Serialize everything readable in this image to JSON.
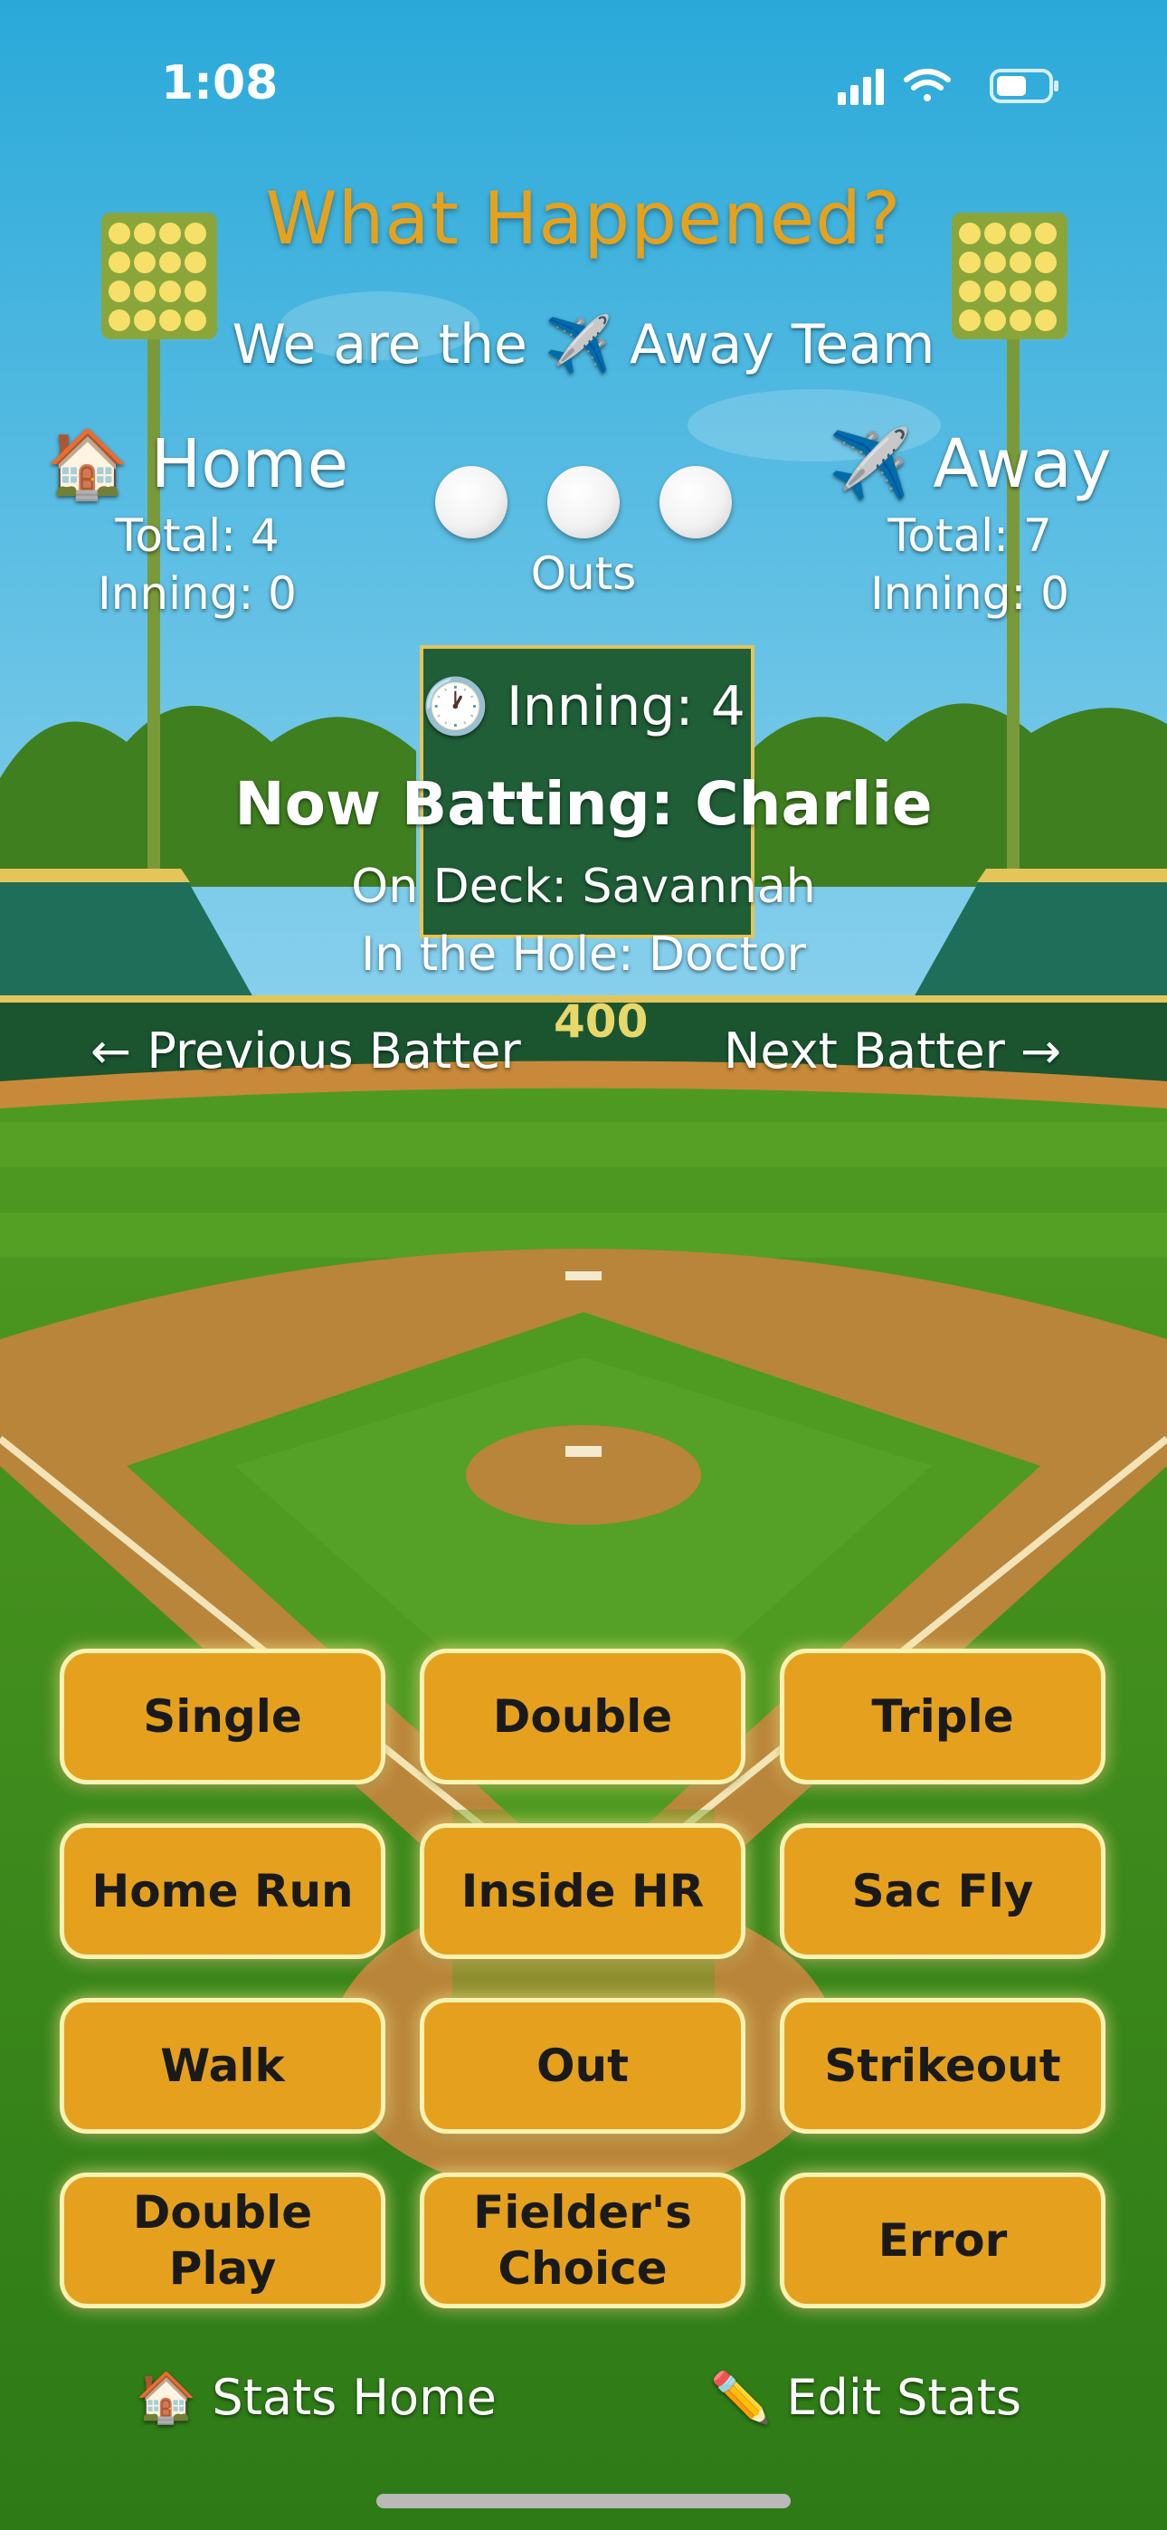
{
  "status_bar": {
    "time": "1:08"
  },
  "header": {
    "title": "What Happened?",
    "team_prefix": "We are the",
    "team_icon": "✈️",
    "team_name": "Away Team"
  },
  "home": {
    "icon": "🏠",
    "name": "Home",
    "total": "Total: 4",
    "inning": "Inning: 0"
  },
  "away": {
    "icon": "✈️",
    "name": "Away",
    "total": "Total: 7",
    "inning": "Inning: 0"
  },
  "outs": {
    "label": "Outs",
    "count": 0,
    "max": 3
  },
  "game": {
    "inning_icon": "🕐",
    "inning": "Inning: 4",
    "now_batting": "Now Batting: Charlie",
    "on_deck": "On Deck: Savannah",
    "in_hole": "In the Hole: Doctor",
    "outfield_sign": "400"
  },
  "nav": {
    "previous": "← Previous Batter",
    "next": "Next Batter →"
  },
  "plays": [
    "Single",
    "Double",
    "Triple",
    "Home Run",
    "Inside HR",
    "Sac Fly",
    "Walk",
    "Out",
    "Strikeout",
    "Double Play",
    "Fielder's Choice",
    "Error"
  ],
  "footer": {
    "stats_home_icon": "🏠",
    "stats_home": "Stats Home",
    "edit_stats_icon": "✏️",
    "edit_stats": "Edit Stats"
  }
}
